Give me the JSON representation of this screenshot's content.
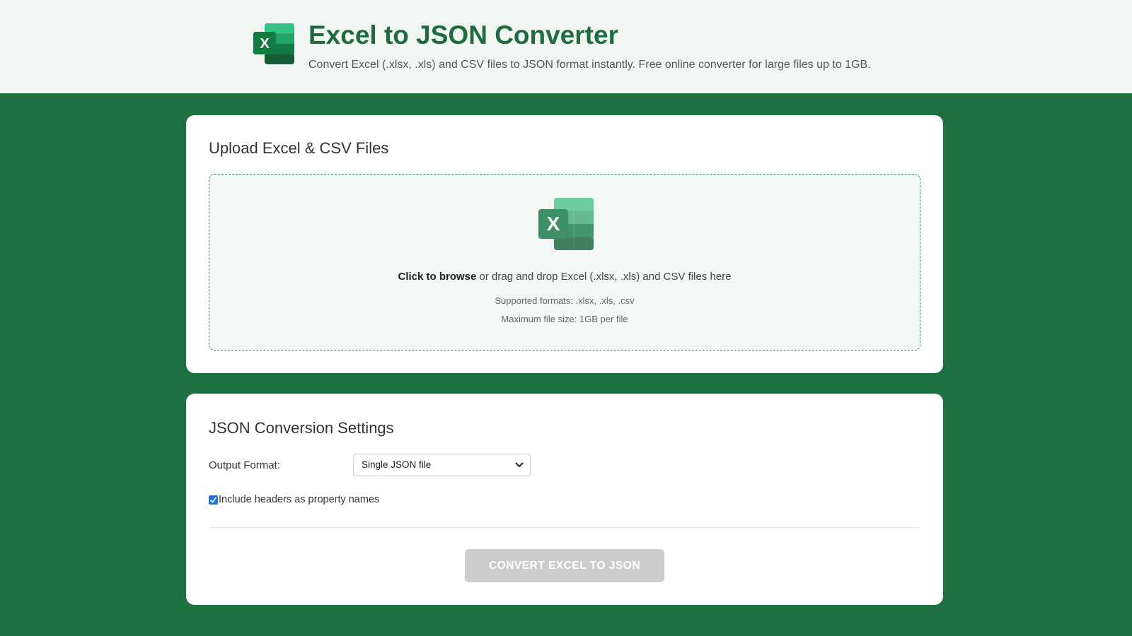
{
  "header": {
    "title": "Excel to JSON Converter",
    "subtitle": "Convert Excel (.xlsx, .xls) and CSV files to JSON format instantly. Free online converter for large files up to 1GB.",
    "logo_icon": "excel-logo-icon"
  },
  "upload": {
    "title": "Upload Excel & CSV Files",
    "icon": "excel-file-icon",
    "browse_label": "Click to browse",
    "drop_text": " or drag and drop Excel (.xlsx, .xls) and CSV files here",
    "supported_formats": "Supported formats: .xlsx, .xls, .csv",
    "max_size": "Maximum file size: 1GB per file"
  },
  "settings": {
    "title": "JSON Conversion Settings",
    "output_format_label": "Output Format:",
    "output_format_value": "Single JSON file",
    "include_headers_label": "Include headers as property names",
    "include_headers_checked": true,
    "convert_button": "CONVERT EXCEL TO JSON"
  },
  "colors": {
    "background": "#1f7040",
    "accent": "#1d6b3e",
    "button_disabled": "#cccccc",
    "checkbox": "#1a73e8"
  }
}
